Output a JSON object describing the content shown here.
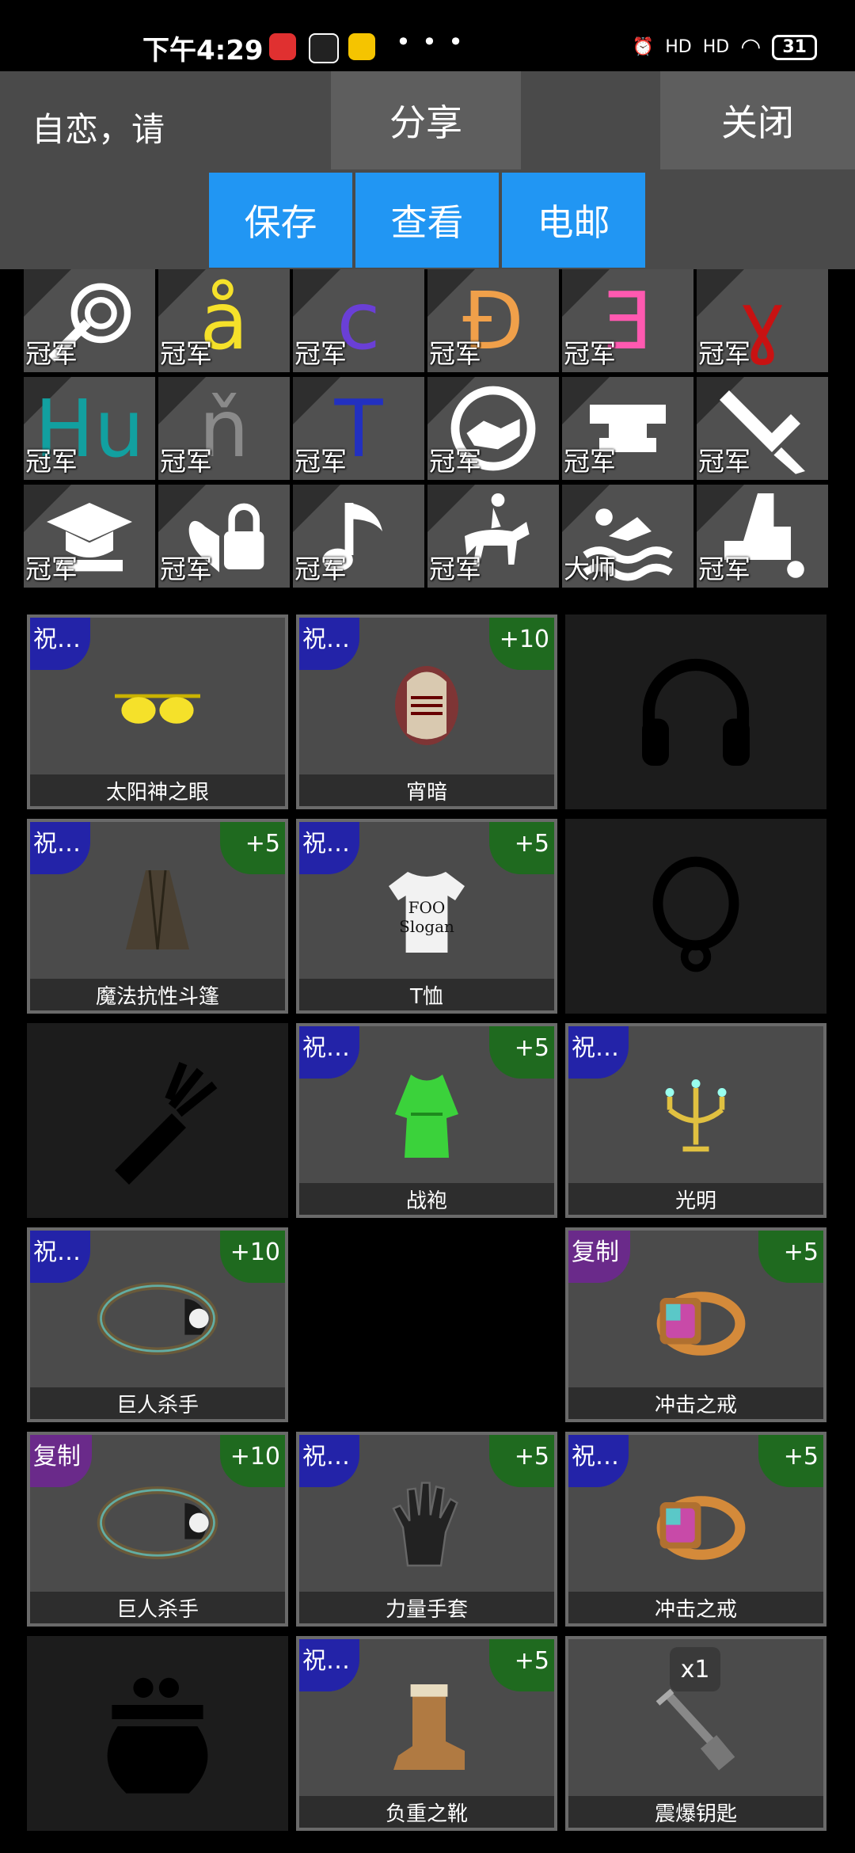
{
  "status_bar": {
    "time": "下午4:29",
    "network_1": "HD",
    "network_2": "HD",
    "battery": "31"
  },
  "header": {
    "title": "自恋，请",
    "share_label": "分享",
    "close_label": "关闭",
    "save_label": "保存",
    "view_label": "查看",
    "email_label": "电邮"
  },
  "badges": [
    {
      "label": "冠军",
      "glyph": "whip-icon",
      "color": "#ffffff"
    },
    {
      "label": "冠军",
      "glyph": "å",
      "color": "#f5e12a"
    },
    {
      "label": "冠军",
      "glyph": "c",
      "color": "#6a3fd6"
    },
    {
      "label": "冠军",
      "glyph": "Đ",
      "color": "#f0a04a"
    },
    {
      "label": "冠军",
      "glyph": "Ǝ",
      "color": "#ff59b0"
    },
    {
      "label": "冠军",
      "glyph": "ɣ",
      "color": "#c81212"
    },
    {
      "label": "冠军",
      "glyph": "Hu",
      "color": "#12a0a0"
    },
    {
      "label": "冠军",
      "glyph": "ň",
      "color": "#8a8a8a"
    },
    {
      "label": "冠军",
      "glyph": "T",
      "color": "#2230c0"
    },
    {
      "label": "冠军",
      "glyph": "handshake-icon",
      "color": "#ffffff"
    },
    {
      "label": "冠军",
      "glyph": "anvil-icon",
      "color": "#ffffff"
    },
    {
      "label": "冠军",
      "glyph": "sword-icon",
      "color": "#ffffff"
    },
    {
      "label": "冠军",
      "glyph": "graduation-icon",
      "color": "#ffffff"
    },
    {
      "label": "冠军",
      "glyph": "lock-heart-icon",
      "color": "#ffffff"
    },
    {
      "label": "冠军",
      "glyph": "music-note-icon",
      "color": "#ffffff"
    },
    {
      "label": "冠军",
      "glyph": "horse-rider-icon",
      "color": "#ffffff"
    },
    {
      "label": "大师",
      "glyph": "swimmer-icon",
      "color": "#ffffff"
    },
    {
      "label": "冠军",
      "glyph": "factory-icon",
      "color": "#ffffff"
    }
  ],
  "equipment": [
    {
      "name": "太阳神之眼",
      "tag": "祝…",
      "tag_type": "blue",
      "bonus": "",
      "art": "sunglasses-icon"
    },
    {
      "name": "宵暗",
      "tag": "祝…",
      "tag_type": "blue",
      "bonus": "+10",
      "art": "helmet-icon"
    },
    {
      "empty": "headphones-icon"
    },
    {
      "name": "魔法抗性斗篷",
      "tag": "祝…",
      "tag_type": "blue",
      "bonus": "+5",
      "art": "cloak-icon"
    },
    {
      "name": "T恤",
      "tag": "祝…",
      "tag_type": "blue",
      "bonus": "+5",
      "art": "tshirt-icon",
      "shirt_text": [
        "FOO",
        "Slogan"
      ]
    },
    {
      "empty": "necklace-icon"
    },
    {
      "empty": "quiver-icon"
    },
    {
      "name": "战袍",
      "tag": "祝…",
      "tag_type": "blue",
      "bonus": "+5",
      "art": "robe-icon"
    },
    {
      "name": "光明",
      "tag": "祝…",
      "tag_type": "blue",
      "bonus": "",
      "art": "candelabra-icon"
    },
    {
      "name": "巨人杀手",
      "tag": "祝…",
      "tag_type": "blue",
      "bonus": "+10",
      "art": "amulet-icon"
    },
    {
      "none": true
    },
    {
      "name": "冲击之戒",
      "tag": "复制",
      "tag_type": "purple",
      "bonus": "+5",
      "art": "ring-icon"
    },
    {
      "name": "巨人杀手",
      "tag": "复制",
      "tag_type": "purple",
      "bonus": "+10",
      "art": "amulet-icon"
    },
    {
      "name": "力量手套",
      "tag": "祝…",
      "tag_type": "blue",
      "bonus": "+5",
      "art": "glove-icon"
    },
    {
      "name": "冲击之戒",
      "tag": "祝…",
      "tag_type": "blue",
      "bonus": "+5",
      "art": "ring-icon"
    },
    {
      "empty": "pouch-icon"
    },
    {
      "name": "负重之靴",
      "tag": "祝…",
      "tag_type": "blue",
      "bonus": "+5",
      "art": "boot-icon"
    },
    {
      "name": "震爆钥匙",
      "tag": "",
      "tag_type": "",
      "bonus": "",
      "art": "key-icon",
      "count": "x1"
    }
  ]
}
